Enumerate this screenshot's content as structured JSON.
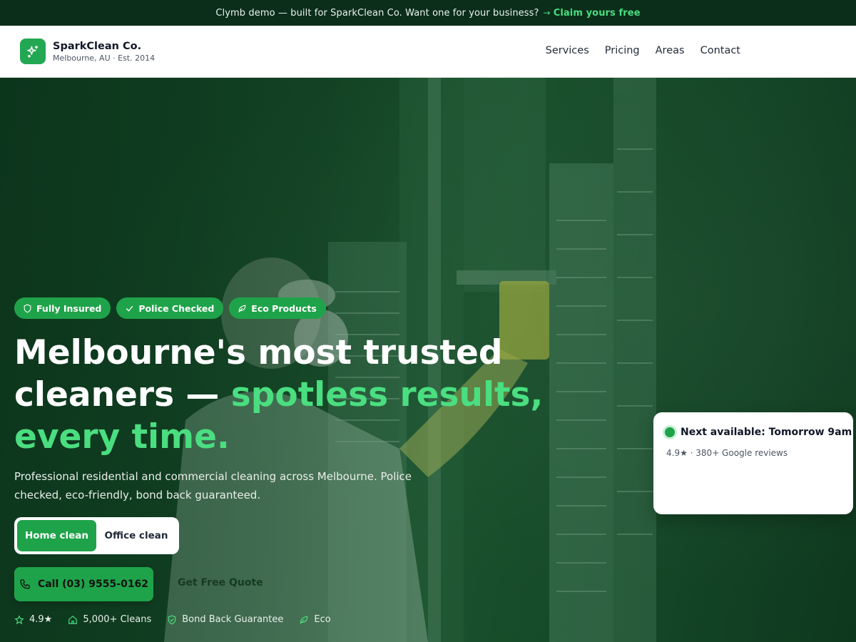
{
  "announcement": {
    "text": "Clymb demo — built for SparkClean Co. Want one for your business?",
    "arrow": "→",
    "link_label": "Claim yours free"
  },
  "brand": {
    "name": "SparkClean Co.",
    "tagline": "Melbourne, AU · Est. 2014",
    "logo_icon": "sparkles-icon"
  },
  "nav": {
    "items": [
      {
        "label": "Services"
      },
      {
        "label": "Pricing"
      },
      {
        "label": "Areas"
      },
      {
        "label": "Contact"
      }
    ]
  },
  "hero": {
    "badges": [
      {
        "label": "Fully Insured",
        "icon": "shield-icon"
      },
      {
        "label": "Police Checked",
        "icon": "check-icon"
      },
      {
        "label": "Eco Products",
        "icon": "leaf-icon"
      }
    ],
    "headline_part1": "Melbourne's most trusted",
    "headline_part2": "cleaners — ",
    "headline_accent": "spotless results, every time.",
    "subtext": "Professional residential and commercial cleaning across Melbourne. Police checked, eco-friendly, bond back guaranteed.",
    "toggle": {
      "options": [
        "Home clean",
        "Office clean"
      ],
      "selected": "Home clean"
    },
    "call_button": {
      "label": "Call (03) 9555-0162",
      "icon": "phone-icon"
    },
    "quote_button": {
      "label": "Get Free Quote"
    },
    "stats": [
      {
        "label": "4.9★",
        "icon": "star-icon"
      },
      {
        "label": "5,000+ Cleans",
        "icon": "home-icon"
      },
      {
        "label": "Bond Back Guarantee",
        "icon": "shield-icon"
      },
      {
        "label": "Eco",
        "icon": "leaf-icon"
      }
    ]
  },
  "availability": {
    "title": "Next available: Tomorrow 9am",
    "subtitle": "4.9★ · 380+ Google reviews"
  },
  "colors": {
    "brand_green": "#1fa34a",
    "accent_green": "#4ade80",
    "announcement_bg": "#0b2e1a"
  }
}
